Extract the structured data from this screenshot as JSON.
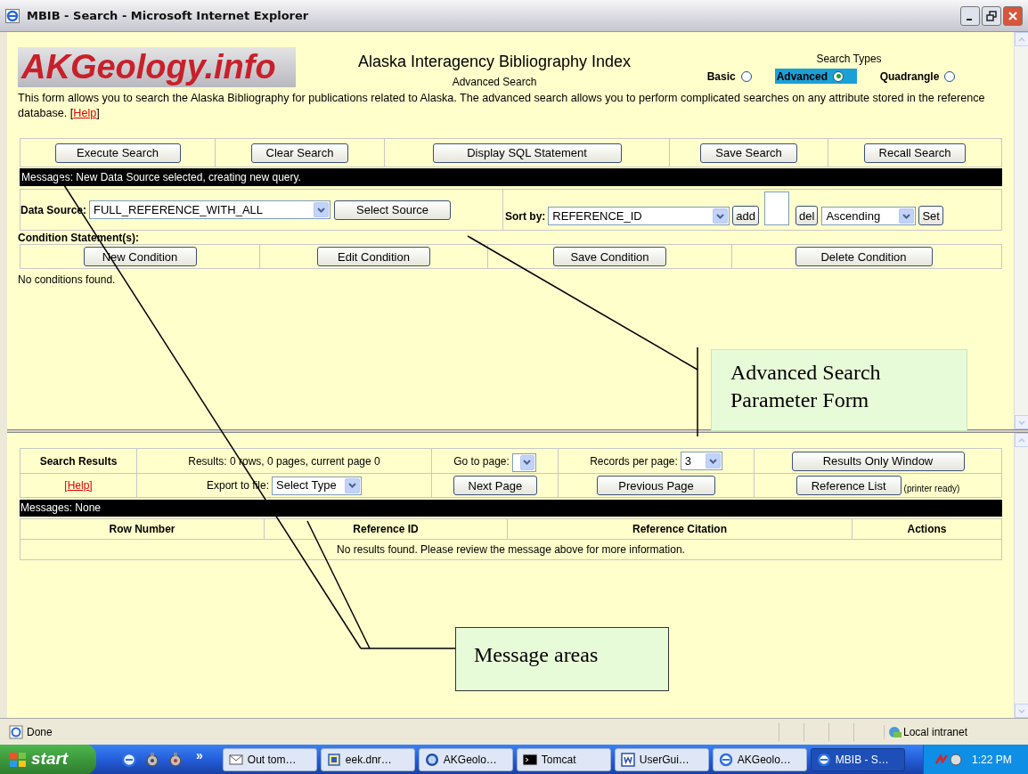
{
  "window": {
    "title": "MBIB - Search - Microsoft Internet Explorer"
  },
  "header": {
    "logo": "AKGeology.info",
    "title": "Alaska Interagency Bibliography Index",
    "subtitle": "Advanced Search",
    "search_types_label": "Search Types",
    "search_types": [
      {
        "label": "Basic",
        "selected": false
      },
      {
        "label": "Advanced",
        "selected": true
      },
      {
        "label": "Quadrangle",
        "selected": false
      }
    ]
  },
  "intro": {
    "text": "This form allows you to search the Alaska Bibliography for publications related to Alaska. The advanced search allows you to perform complicated searches on any attribute stored in the reference database. [",
    "link": "Help",
    "end": "]"
  },
  "toolbar": [
    "Execute Search",
    "Clear Search",
    "Display SQL Statement",
    "Save Search",
    "Recall Search"
  ],
  "messages_top": "Messages: New Data Source selected, creating new query.",
  "data_source": {
    "label": "Data Source:",
    "value": "FULL_REFERENCE_WITH_ALL",
    "button": "Select Source"
  },
  "sort": {
    "label": "Sort by:",
    "value": "REFERENCE_ID",
    "add": "add",
    "del": "del",
    "order": "Ascending",
    "set": "Set"
  },
  "conditions": {
    "label": "Condition Statement(s):",
    "buttons": [
      "New Condition",
      "Edit Condition",
      "Save Condition",
      "Delete Condition"
    ],
    "empty": "No conditions found."
  },
  "results": {
    "title": "Search Results",
    "summary": "Results: 0 rows, 0 pages, current page 0",
    "goto_label": "Go to page:",
    "records_label": "Records per page:",
    "records_value": "3",
    "results_only": "Results Only Window",
    "help_open": "[",
    "help": "Help",
    "help_close": "]",
    "export_label": "Export to file:",
    "export_value": "Select Type",
    "next": "Next Page",
    "previous": "Previous Page",
    "reference_list": "Reference List",
    "printer_note": "(printer ready)",
    "messages": "Messages: None",
    "columns": [
      "Row Number",
      "Reference ID",
      "Reference Citation",
      "Actions"
    ],
    "empty": "No results found. Please review the message above for more information."
  },
  "status_bar": {
    "text": "Done",
    "zone": "Local intranet"
  },
  "taskbar": {
    "start": "start",
    "overflow": "»",
    "clock": "1:22 PM",
    "tasks": [
      {
        "label": "Out tom…",
        "kind": "mail",
        "selected": false
      },
      {
        "label": "eek.dnr…",
        "kind": "app",
        "selected": false
      },
      {
        "label": "AKGeolo…",
        "kind": "netscape",
        "selected": false
      },
      {
        "label": "Tomcat",
        "kind": "console",
        "selected": false
      },
      {
        "label": "UserGui…",
        "kind": "word",
        "selected": false
      },
      {
        "label": "AKGeolo…",
        "kind": "ie",
        "selected": false
      },
      {
        "label": "MBIB - S…",
        "kind": "ie",
        "selected": true
      }
    ]
  },
  "annotations": [
    {
      "text": "Advanced Search Parameter Form"
    },
    {
      "text": "Message areas"
    }
  ]
}
